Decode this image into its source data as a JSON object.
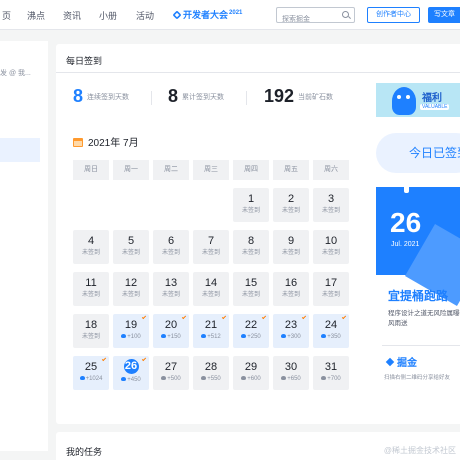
{
  "nav": {
    "items": [
      "页",
      "沸点",
      "资讯",
      "小册",
      "活动"
    ],
    "event_logo": "开发者大会",
    "event_year": "2021",
    "search_placeholder": "探索掘金",
    "creator_btn": "创作者中心",
    "write_btn": "写文章"
  },
  "left": {
    "snippet": "发 @ 我..."
  },
  "card": {
    "title": "每日签到"
  },
  "stats": [
    {
      "value": "8",
      "label": "连续签到天数"
    },
    {
      "value": "8",
      "label": "累计签到天数"
    },
    {
      "value": "192",
      "label": "当前矿石数"
    }
  ],
  "calendar": {
    "month": "2021年 7月",
    "weekdays": [
      "周日",
      "周一",
      "周二",
      "周三",
      "周四",
      "周五",
      "周六"
    ],
    "days": [
      {
        "day": "1",
        "status": "未签到"
      },
      {
        "day": "2",
        "status": "未签到"
      },
      {
        "day": "3",
        "status": "未签到"
      },
      {
        "day": "4",
        "status": "未签到"
      },
      {
        "day": "5",
        "status": "未签到"
      },
      {
        "day": "6",
        "status": "未签到"
      },
      {
        "day": "7",
        "status": "未签到"
      },
      {
        "day": "8",
        "status": "未签到"
      },
      {
        "day": "9",
        "status": "未签到"
      },
      {
        "day": "10",
        "status": "未签到"
      },
      {
        "day": "11",
        "status": "未签到"
      },
      {
        "day": "12",
        "status": "未签到"
      },
      {
        "day": "13",
        "status": "未签到"
      },
      {
        "day": "14",
        "status": "未签到"
      },
      {
        "day": "15",
        "status": "未签到"
      },
      {
        "day": "16",
        "status": "未签到"
      },
      {
        "day": "17",
        "status": "未签到"
      },
      {
        "day": "18",
        "status": "未签到"
      },
      {
        "day": "19",
        "status": "+100",
        "signed": true
      },
      {
        "day": "20",
        "status": "+150",
        "signed": true
      },
      {
        "day": "21",
        "status": "+512",
        "signed": true
      },
      {
        "day": "22",
        "status": "+250",
        "signed": true
      },
      {
        "day": "23",
        "status": "+300",
        "signed": true
      },
      {
        "day": "24",
        "status": "+350",
        "signed": true
      },
      {
        "day": "25",
        "status": "+1024",
        "signed": true
      },
      {
        "day": "26",
        "status": "+450",
        "signed": true,
        "today": true
      },
      {
        "day": "27",
        "status": "+500"
      },
      {
        "day": "28",
        "status": "+550"
      },
      {
        "day": "29",
        "status": "+600"
      },
      {
        "day": "30",
        "status": "+650"
      },
      {
        "day": "31",
        "status": "+700"
      }
    ]
  },
  "right": {
    "banner_title": "福利",
    "banner_sub": "VALUABLE",
    "signin_btn": "今日已签到",
    "poster_day": "26",
    "poster_date": "Jul. 2021",
    "poster_tag": "宜提桶跑路",
    "poster_text": "程序设计之道无风险属曝微风雨送",
    "brand": "掘金",
    "brand_caption": "扫描右侧二维码分享给好友"
  },
  "tasks": {
    "title": "我的任务"
  },
  "watermark": "@稀土掘金技术社区"
}
